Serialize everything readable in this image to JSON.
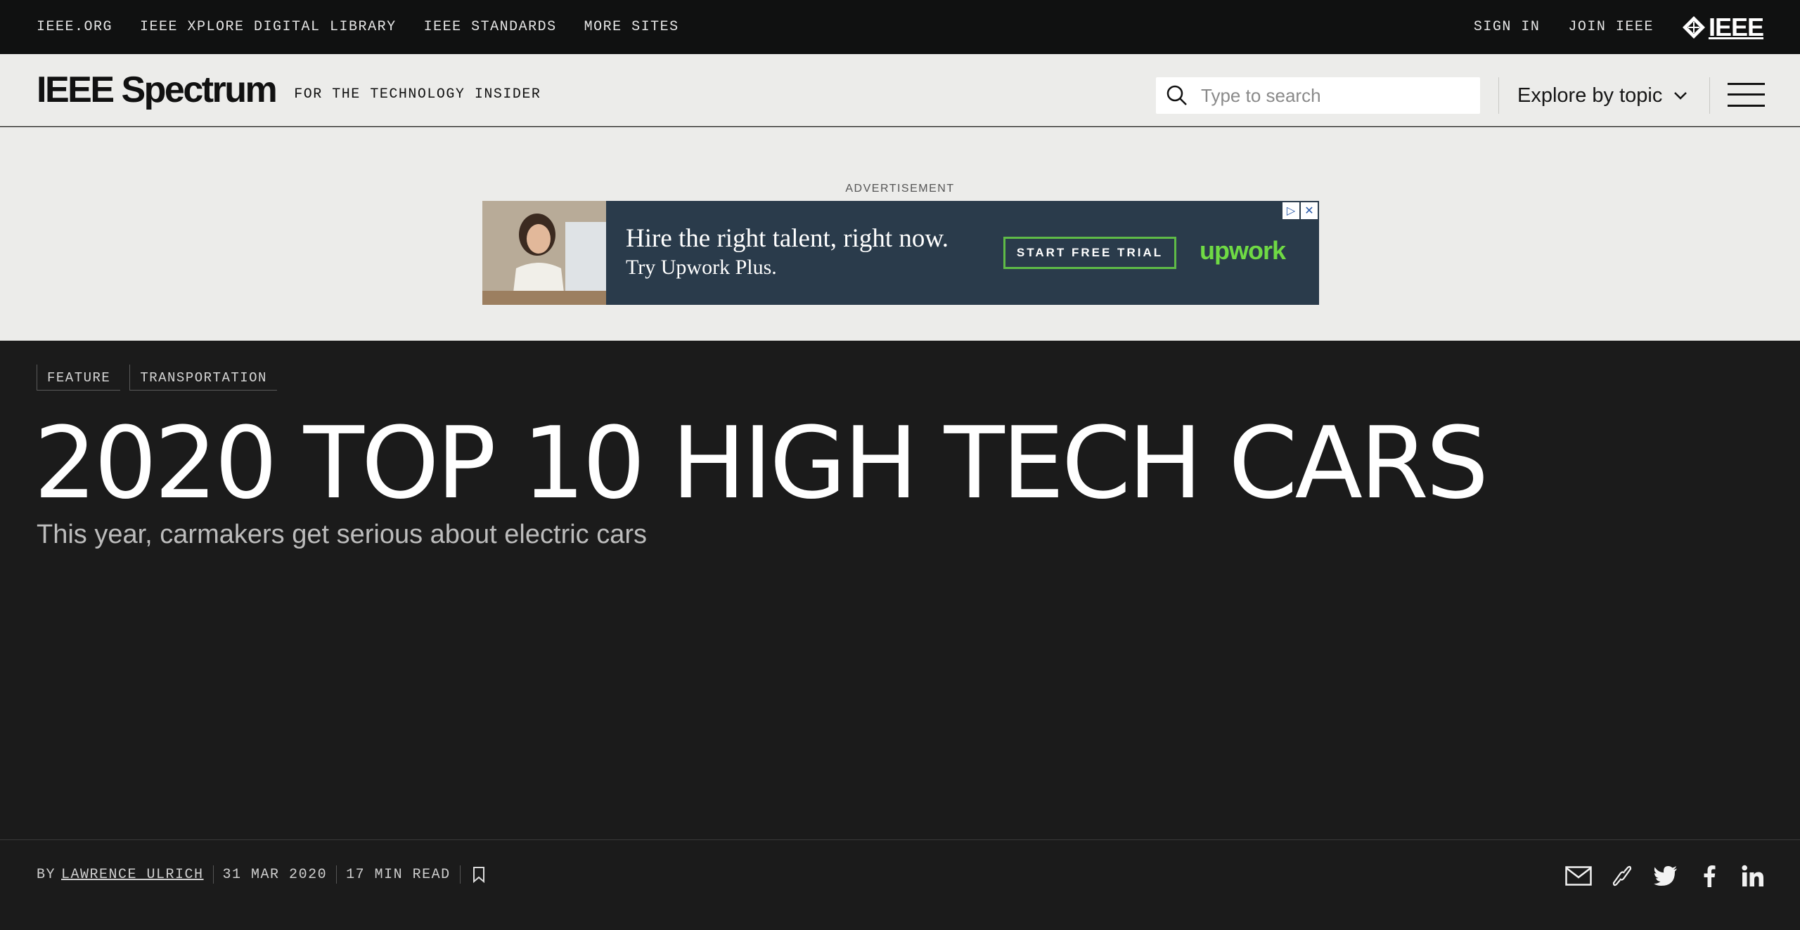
{
  "topbar": {
    "links": [
      "IEEE.ORG",
      "IEEE XPLORE DIGITAL LIBRARY",
      "IEEE STANDARDS",
      "MORE SITES"
    ],
    "sign_in": "SIGN IN",
    "join": "JOIN IEEE",
    "logo_text": "IEEE"
  },
  "header": {
    "brand": "IEEE Spectrum",
    "tagline": "FOR THE TECHNOLOGY INSIDER",
    "search_placeholder": "Type to search",
    "explore_label": "Explore by topic"
  },
  "ad": {
    "label": "ADVERTISEMENT",
    "headline": "Hire the right talent, right now.",
    "subline": "Try Upwork Plus.",
    "cta": "START FREE TRIAL",
    "brand": "upwork"
  },
  "article": {
    "tags": [
      "FEATURE",
      "TRANSPORTATION"
    ],
    "title": "2020 TOP 10 HIGH TECH CARS",
    "dek": "This year, carmakers get serious about electric cars",
    "byline_prefix": "BY",
    "author": "LAWRENCE ULRICH",
    "date": "31 MAR 2020",
    "read_time": "17 MIN READ"
  },
  "icons": {
    "search": "search-icon",
    "explore": "chevron-down-icon",
    "menu": "hamburger-icon",
    "bookmark": "bookmark-icon",
    "share": [
      "email-icon",
      "link-icon",
      "twitter-icon",
      "facebook-icon",
      "linkedin-icon"
    ]
  },
  "colors": {
    "topbar_bg": "#101111",
    "header_bg": "#ececea",
    "article_bg": "#1b1b1b",
    "ad_bg": "#2a3b4b",
    "ad_accent": "#6fda44"
  }
}
